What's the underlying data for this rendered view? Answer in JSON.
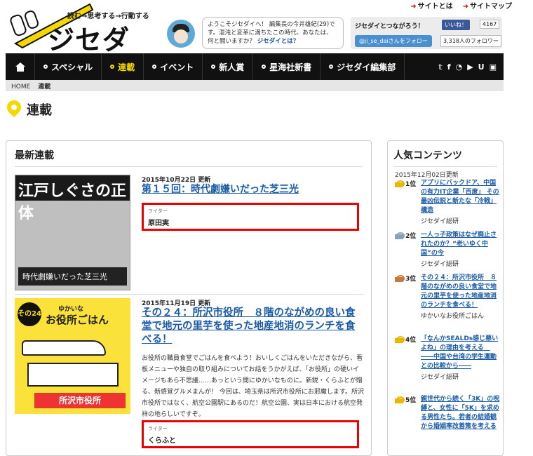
{
  "header": {
    "links": [
      "サイトとは",
      "サイトマップ"
    ],
    "tagline": "読む→思考する→行動する",
    "logo_text": "ジセダイ",
    "welcome_text": "ようこそジセダイへ！ 編集長の今井雄紀(29)です。混沌と変革に満ちたこの時代、あなたは、何と闘いますか？",
    "welcome_link": "ジセダイとは？",
    "social_title": "ジセダイとつながろう！",
    "like_label": "いいね！",
    "like_count": "4167",
    "follow_label": "@ji_se_daiさんをフォロー",
    "follower_count": "3,318人のフォロワー"
  },
  "nav": {
    "items": [
      "スペシャル",
      "連載",
      "イベント",
      "新人賞",
      "星海社新書",
      "ジセダイ編集部"
    ],
    "active": "連載",
    "social_icons": [
      "twitter-icon",
      "facebook-icon",
      "rss-icon",
      "youtube-icon",
      "ustream-icon",
      "note-icon"
    ]
  },
  "breadcrumb": {
    "home": "HOME",
    "current": "連載"
  },
  "page_title": "連載",
  "main": {
    "heading": "最新連載",
    "articles": [
      {
        "date": "2015年10月22日 更新",
        "title": "第１５回：時代劇嫌いだった芝三光",
        "writer_label": "ライター",
        "writer": "原田実",
        "thumb_title": "江戸しぐさの正体",
        "thumb_banner": "時代劇嫌いだった芝三光"
      },
      {
        "date": "2015年11月19日 更新",
        "title": "その２４：所沢市役所　８階のながめの良い食堂で地元の里芋を使った地産地消のランチを食べる！",
        "excerpt": "お役所の職員食堂でごはんを食べよう！おいしくごはんをいただきながら、看板メニューや独自の取り組みについてお話をうかがえば、「お役所」の硬いイメージもあら不思議……あっという間にゆかいなものに。新鋭・くらふとが贈る、新感覚グルメまんが！ 今回は、埼玉県は所沢市役所にお邪魔します。所沢市役所ではなく、航空公園駅にあるのだ！航空公園、実は日本における航空発祥の地らしいですぞ。",
        "writer_label": "ライター",
        "writer": "くらふと",
        "thumb_badge": "その24",
        "thumb_small": "ゆかいな",
        "thumb_title": "お役所ごはん",
        "thumb_sign": "所沢市役所"
      }
    ]
  },
  "sidebar": {
    "heading": "人気コンテンツ",
    "date": "2015年12月02日更新",
    "rankings": [
      {
        "rank": "1位",
        "title": "アプリにバックドア、中国の有力IT企業「百度」 その最凶伝説と新たな「冷戦」構造",
        "source": "ジセダイ総研",
        "color": "#e6b800"
      },
      {
        "rank": "2位",
        "title": "一人っ子政策はなぜ廃止されたのか？“老いゆく中国”の今",
        "source": "ジセダイ総研",
        "color": "#8aa0b4"
      },
      {
        "rank": "3位",
        "title": "その２４：所沢市役所　８階のながめの良い食堂で地元の里芋を使った地産地消のランチを食べる！",
        "source": "ゆかいなお役所ごはん",
        "color": "#c8793b"
      },
      {
        "rank": "4位",
        "title": "「なんかSEALDs感じ悪いよね」の理由を考える　――中国や台湾の学生運動との比較から――",
        "source": "ジセダイ総研",
        "color": "#e6b800"
      },
      {
        "rank": "5位",
        "title": "親世代から続く「3K」の呪縛と、女性に「5K」を求める男性たち。若者の結婚観から婚姻率改善策を考える",
        "source": "",
        "color": "#e6b800"
      }
    ]
  }
}
